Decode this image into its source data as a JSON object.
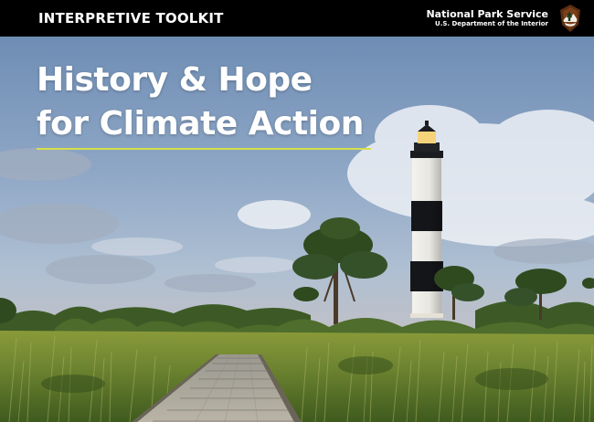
{
  "header": {
    "label": "INTERPRETIVE TOOLKIT",
    "agency": "National Park Service",
    "department": "U.S. Department of the Interior",
    "logo_icon": "nps-arrowhead-icon"
  },
  "cover": {
    "title_line1": "History & Hope",
    "title_line2": "for Climate Action",
    "image": "lighthouse-boardwalk-photo",
    "colors": {
      "bar": "#000000",
      "rule": "#d4e04a",
      "title": "#ffffff"
    }
  }
}
